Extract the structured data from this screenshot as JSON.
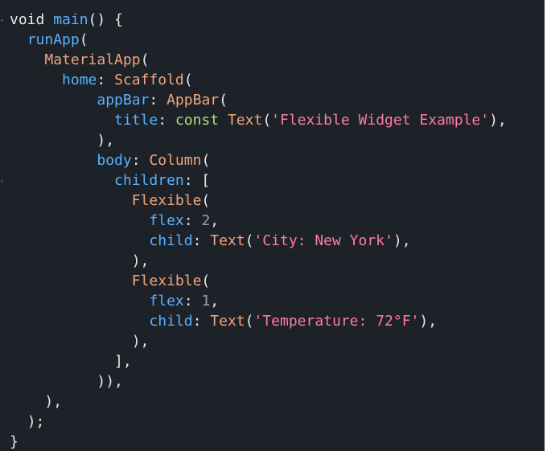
{
  "code": {
    "lines": [
      [
        {
          "text": "void ",
          "kind": "kw"
        },
        {
          "text": "main",
          "kind": "fn"
        },
        {
          "text": "() {",
          "kind": "punc"
        }
      ],
      [
        {
          "text": "  ",
          "kind": "plain"
        },
        {
          "text": "runApp",
          "kind": "fn"
        },
        {
          "text": "(",
          "kind": "punc"
        }
      ],
      [
        {
          "text": "    ",
          "kind": "plain"
        },
        {
          "text": "MaterialApp",
          "kind": "ty"
        },
        {
          "text": "(",
          "kind": "punc"
        }
      ],
      [
        {
          "text": "      ",
          "kind": "plain"
        },
        {
          "text": "home",
          "kind": "prop"
        },
        {
          "text": ": ",
          "kind": "punc"
        },
        {
          "text": "Scaffold",
          "kind": "ty"
        },
        {
          "text": "(",
          "kind": "punc"
        }
      ],
      [
        {
          "text": "          ",
          "kind": "plain"
        },
        {
          "text": "appBar",
          "kind": "prop"
        },
        {
          "text": ": ",
          "kind": "punc"
        },
        {
          "text": "AppBar",
          "kind": "ty"
        },
        {
          "text": "(",
          "kind": "punc"
        }
      ],
      [
        {
          "text": "            ",
          "kind": "plain"
        },
        {
          "text": "title",
          "kind": "prop"
        },
        {
          "text": ": ",
          "kind": "punc"
        },
        {
          "text": "const ",
          "kind": "const"
        },
        {
          "text": "Text",
          "kind": "ty"
        },
        {
          "text": "(",
          "kind": "punc"
        },
        {
          "text": "'Flexible Widget Example'",
          "kind": "str"
        },
        {
          "text": "),",
          "kind": "punc"
        }
      ],
      [
        {
          "text": "          ",
          "kind": "plain"
        },
        {
          "text": "),",
          "kind": "punc"
        }
      ],
      [
        {
          "text": "          ",
          "kind": "plain"
        },
        {
          "text": "body",
          "kind": "prop"
        },
        {
          "text": ": ",
          "kind": "punc"
        },
        {
          "text": "Column",
          "kind": "ty"
        },
        {
          "text": "(",
          "kind": "punc"
        }
      ],
      [
        {
          "text": "            ",
          "kind": "plain"
        },
        {
          "text": "children",
          "kind": "prop"
        },
        {
          "text": ": [",
          "kind": "punc"
        }
      ],
      [
        {
          "text": "              ",
          "kind": "plain"
        },
        {
          "text": "Flexible",
          "kind": "ty"
        },
        {
          "text": "(",
          "kind": "punc"
        }
      ],
      [
        {
          "text": "                ",
          "kind": "plain"
        },
        {
          "text": "flex",
          "kind": "prop"
        },
        {
          "text": ": ",
          "kind": "punc"
        },
        {
          "text": "2",
          "kind": "num"
        },
        {
          "text": ",",
          "kind": "punc"
        }
      ],
      [
        {
          "text": "                ",
          "kind": "plain"
        },
        {
          "text": "child",
          "kind": "prop"
        },
        {
          "text": ": ",
          "kind": "punc"
        },
        {
          "text": "Text",
          "kind": "ty"
        },
        {
          "text": "(",
          "kind": "punc"
        },
        {
          "text": "'City: New York'",
          "kind": "str"
        },
        {
          "text": "),",
          "kind": "punc"
        }
      ],
      [
        {
          "text": "              ",
          "kind": "plain"
        },
        {
          "text": "),",
          "kind": "punc"
        }
      ],
      [
        {
          "text": "              ",
          "kind": "plain"
        },
        {
          "text": "Flexible",
          "kind": "ty"
        },
        {
          "text": "(",
          "kind": "punc"
        }
      ],
      [
        {
          "text": "                ",
          "kind": "plain"
        },
        {
          "text": "flex",
          "kind": "prop"
        },
        {
          "text": ": ",
          "kind": "punc"
        },
        {
          "text": "1",
          "kind": "num"
        },
        {
          "text": ",",
          "kind": "punc"
        }
      ],
      [
        {
          "text": "                ",
          "kind": "plain"
        },
        {
          "text": "child",
          "kind": "prop"
        },
        {
          "text": ": ",
          "kind": "punc"
        },
        {
          "text": "Text",
          "kind": "ty"
        },
        {
          "text": "(",
          "kind": "punc"
        },
        {
          "text": "'Temperature: 72°F'",
          "kind": "str"
        },
        {
          "text": "),",
          "kind": "punc"
        }
      ],
      [
        {
          "text": "              ",
          "kind": "plain"
        },
        {
          "text": "),",
          "kind": "punc"
        }
      ],
      [
        {
          "text": "            ",
          "kind": "plain"
        },
        {
          "text": "],",
          "kind": "punc"
        }
      ],
      [
        {
          "text": "          ",
          "kind": "plain"
        },
        {
          "text": ")),",
          "kind": "punc"
        }
      ],
      [
        {
          "text": "    ",
          "kind": "plain"
        },
        {
          "text": "),",
          "kind": "punc"
        }
      ],
      [
        {
          "text": "  ",
          "kind": "plain"
        },
        {
          "text": ");",
          "kind": "punc"
        }
      ],
      [
        {
          "text": "}",
          "kind": "punc"
        }
      ]
    ],
    "fold_lines": [
      0,
      8
    ]
  },
  "icons": {
    "fold": "chevron-down-icon"
  }
}
